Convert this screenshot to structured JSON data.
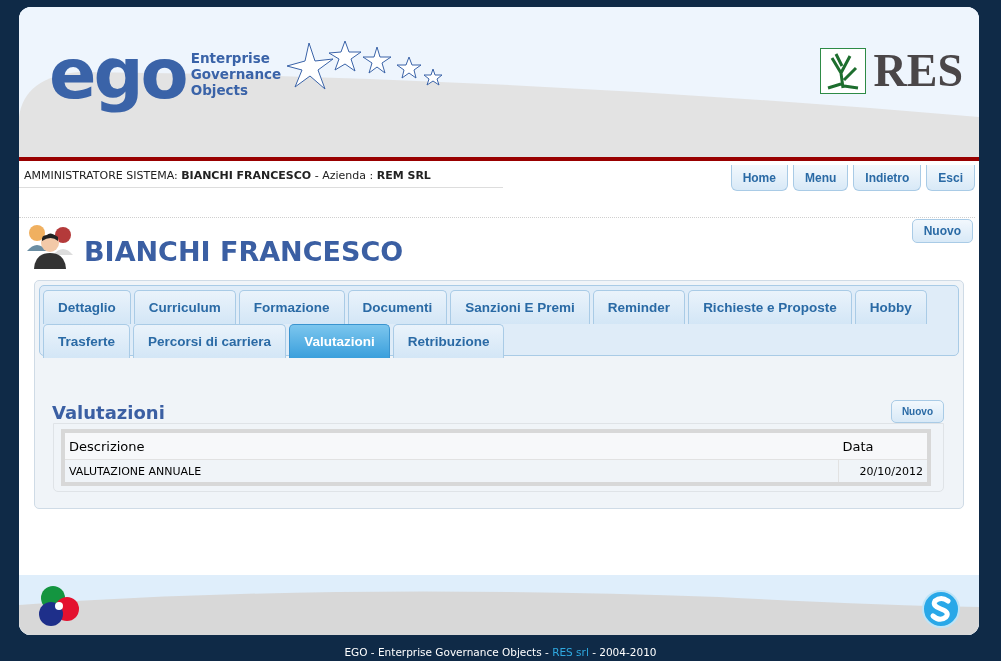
{
  "header": {
    "logo_text": "ego",
    "logo_tagline": [
      "Enterprise",
      "Governance",
      "Objects"
    ],
    "partner_logo_text": "RES"
  },
  "user_bar": {
    "info": "AMMINISTRATORE SISTEMA: **BIANCHI FRANCESCO** - Azienda : **REM SRL**",
    "buttons": [
      "Home",
      "Menu",
      "Indietro",
      "Esci"
    ]
  },
  "page": {
    "new_button": "Nuovo",
    "title": "BIANCHI FRANCESCO"
  },
  "tab_rows": [
    [
      {
        "label": "Dettaglio",
        "selected": false
      },
      {
        "label": "Curriculum",
        "selected": false
      },
      {
        "label": "Formazione",
        "selected": false
      },
      {
        "label": "Documenti",
        "selected": false
      },
      {
        "label": "Sanzioni E Premi",
        "selected": false
      },
      {
        "label": "Reminder",
        "selected": false
      },
      {
        "label": "Richieste e Proposte",
        "selected": false
      },
      {
        "label": "Hobby",
        "selected": false
      }
    ],
    [
      {
        "label": "Trasferte",
        "selected": false
      },
      {
        "label": "Percorsi di carriera",
        "selected": false
      },
      {
        "label": "Valutazioni",
        "selected": true
      },
      {
        "label": "Retribuzione",
        "selected": false
      }
    ]
  ],
  "section": {
    "title": "Valutazioni",
    "new_button": "Nuovo",
    "table": {
      "columns": [
        "Descrizione",
        "Data"
      ],
      "rows": [
        [
          "VALUTAZIONE ANNUALE",
          "20/10/2012"
        ]
      ]
    }
  },
  "footer": {
    "text_before": "EGO - Enterprise Governance Objects -",
    "link": "RES srl",
    "text_after": "- 2004-2010"
  }
}
